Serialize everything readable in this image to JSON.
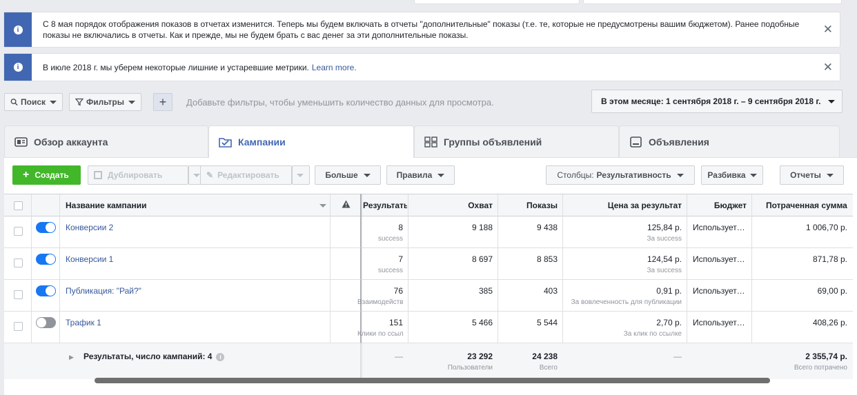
{
  "banners": [
    {
      "text": "С 8 мая порядок отображения показов в отчетах изменится. Теперь мы будем включать в отчеты \"дополнительные\" показы (т.е. те, которые не предусмотрены вашим бюджетом). Ранее подобные показы не включались в отчеты. Как и прежде, мы не будем брать с вас денег за эти дополнительные показы.",
      "link": ""
    },
    {
      "text": "В июле 2018 г. мы уберем некоторые лишние и устаревшие метрики.",
      "link": "Learn more."
    }
  ],
  "filterbar": {
    "search": "Поиск",
    "filters": "Фильтры",
    "hint": "Добавьте фильтры, чтобы уменьшить количество данных для просмотра.",
    "date": "В этом месяце: 1 сентября 2018 г. – 9 сентября 2018 г."
  },
  "tabs": [
    "Обзор аккаунта",
    "Кампании",
    "Группы объявлений",
    "Объявления"
  ],
  "actions": {
    "create": "Создать",
    "duplicate": "Дублировать",
    "edit": "Редактировать",
    "more": "Больше",
    "rules": "Правила",
    "columns_prefix": "Столбцы:",
    "columns_value": "Результативность",
    "breakdown": "Разбивка",
    "reports": "Отчеты"
  },
  "table": {
    "headers": {
      "name": "Название кампании",
      "results": "Результаты",
      "reach": "Охват",
      "impressions": "Показы",
      "cost": "Цена за результат",
      "budget": "Бюджет",
      "spent": "Потраченная сумма"
    },
    "rows": [
      {
        "name": "Конверсии 2",
        "on": true,
        "results": "8",
        "results_sub": "success",
        "reach": "9 188",
        "impressions": "9 438",
        "cost": "125,84 р.",
        "cost_sub": "За success",
        "budget": "Используется...",
        "spent": "1 006,70 р."
      },
      {
        "name": "Конверсии 1",
        "on": true,
        "results": "7",
        "results_sub": "success",
        "reach": "8 697",
        "impressions": "8 853",
        "cost": "124,54 р.",
        "cost_sub": "За success",
        "budget": "Используется...",
        "spent": "871,78 р."
      },
      {
        "name": "Публикация: \"Рай?\"",
        "on": true,
        "results": "76",
        "results_sub": "Взаимодействия",
        "reach": "385",
        "impressions": "403",
        "cost": "0,91 р.",
        "cost_sub": "За вовлеченность для публикации",
        "budget": "Используется...",
        "spent": "69,00 р."
      },
      {
        "name": "Трафик 1",
        "on": false,
        "results": "151",
        "results_sub": "Клики по ссылке",
        "reach": "5 466",
        "impressions": "5 544",
        "cost": "2,70 р.",
        "cost_sub": "За клик по ссылке",
        "budget": "Используется...",
        "spent": "408,26 р."
      }
    ],
    "total": {
      "label": "Результаты, число кампаний: 4",
      "results": "—",
      "reach": "23 292",
      "reach_sub": "Пользователи",
      "impressions": "24 238",
      "impressions_sub": "Всего",
      "cost": "—",
      "budget": "",
      "spent": "2 355,74 р.",
      "spent_sub": "Всего потрачено"
    }
  }
}
